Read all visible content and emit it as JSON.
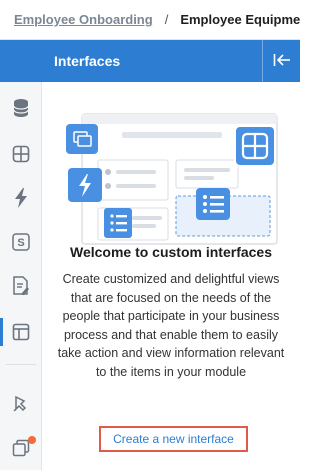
{
  "breadcrumb": {
    "parent": "Employee Onboarding",
    "separator": "/",
    "current": "Employee Equipment Re"
  },
  "panel": {
    "title": "Interfaces"
  },
  "rail": {
    "items": [
      {
        "icon": "database-icon"
      },
      {
        "icon": "grid-icon"
      },
      {
        "icon": "lightning-icon"
      },
      {
        "icon": "s-box-icon",
        "glyph": "S"
      },
      {
        "icon": "document-edit-icon"
      },
      {
        "icon": "layout-icon",
        "active": true
      },
      {
        "icon": "pin-icon"
      },
      {
        "icon": "layers-icon",
        "notification": true
      }
    ]
  },
  "welcome": {
    "title": "Welcome to custom interfaces",
    "description": "Create customized and delightful views that are focused on the needs of the people that participate in your business process and that enable them to easily take action and view information relevant to the items in your module",
    "create_link": "Create a new interface"
  },
  "colors": {
    "accent": "#2d7dd2",
    "highlight_border": "#e05a4a",
    "notification": "#f26b3a"
  }
}
